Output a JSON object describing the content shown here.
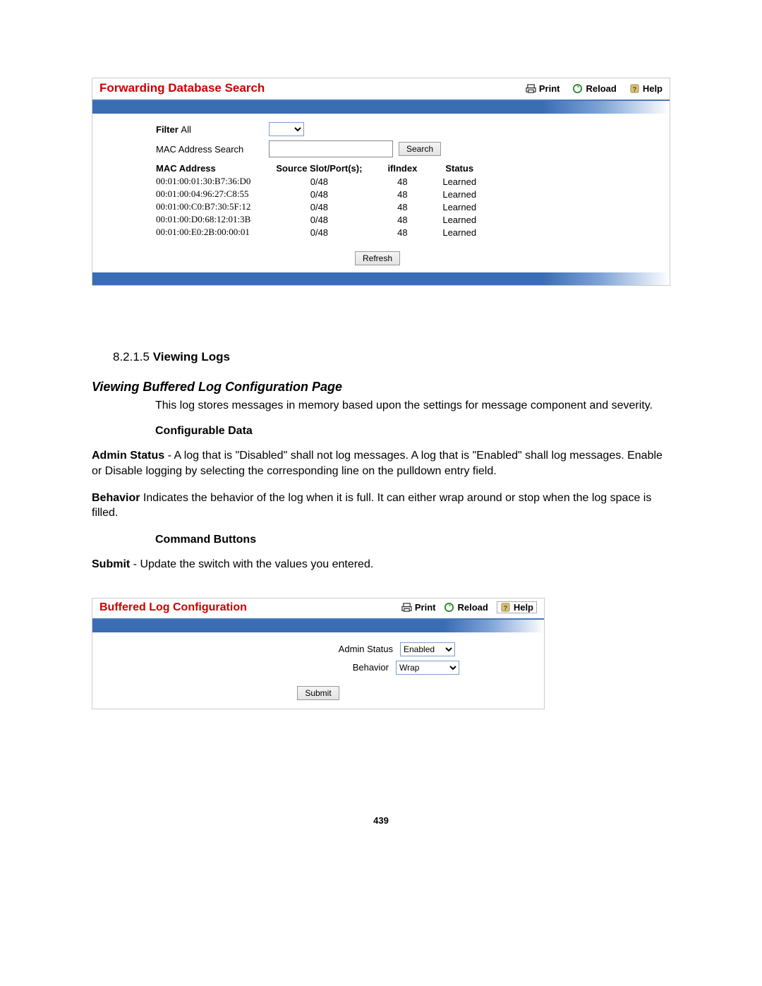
{
  "panel1": {
    "title": "Forwarding Database Search",
    "links": {
      "print": "Print",
      "reload": "Reload",
      "help": "Help"
    },
    "filter_label": "Filter",
    "filter_value": "All",
    "mac_search_label": "MAC Address Search",
    "search_btn": "Search",
    "refresh_btn": "Refresh",
    "table": {
      "headers": [
        "MAC Address",
        "Source Slot/Port(s);",
        "ifIndex",
        "Status"
      ],
      "rows": [
        [
          "00:01:00:01:30:B7:36:D0",
          "0/48",
          "48",
          "Learned"
        ],
        [
          "00:01:00:04:96:27:C8:55",
          "0/48",
          "48",
          "Learned"
        ],
        [
          "00:01:00:C0:B7:30:5F:12",
          "0/48",
          "48",
          "Learned"
        ],
        [
          "00:01:00:D0:68:12:01:3B",
          "0/48",
          "48",
          "Learned"
        ],
        [
          "00:01:00:E0:2B:00:00:01",
          "0/48",
          "48",
          "Learned"
        ]
      ]
    }
  },
  "doc": {
    "section_number": "8.2.1.5",
    "section_title": "Viewing Logs",
    "subheading": "Viewing Buffered Log Configuration Page",
    "intro": "This log stores messages in memory based upon the settings for message component and severity.",
    "cfg_data_label": "Configurable Data",
    "admin_status_label": "Admin Status",
    "admin_status_text": " - A log that is \"Disabled\" shall not log messages. A log that is \"Enabled\" shall log messages. Enable or Disable logging by selecting the corresponding line on the pulldown entry field.",
    "behavior_label": "Behavior",
    "behavior_text": " Indicates the behavior of the log when it is full. It can either wrap around or stop when the log space is filled.",
    "cmd_buttons_label": "Command Buttons",
    "submit_label": "Submit",
    "submit_text": " - Update the switch with the values you entered."
  },
  "panel2": {
    "title": "Buffered Log Configuration",
    "links": {
      "print": "Print",
      "reload": "Reload",
      "help": "Help"
    },
    "admin_status_label": "Admin Status",
    "admin_status_value": "Enabled",
    "behavior_label": "Behavior",
    "behavior_value": "Wrap",
    "submit_btn": "Submit"
  },
  "page_number": "439"
}
